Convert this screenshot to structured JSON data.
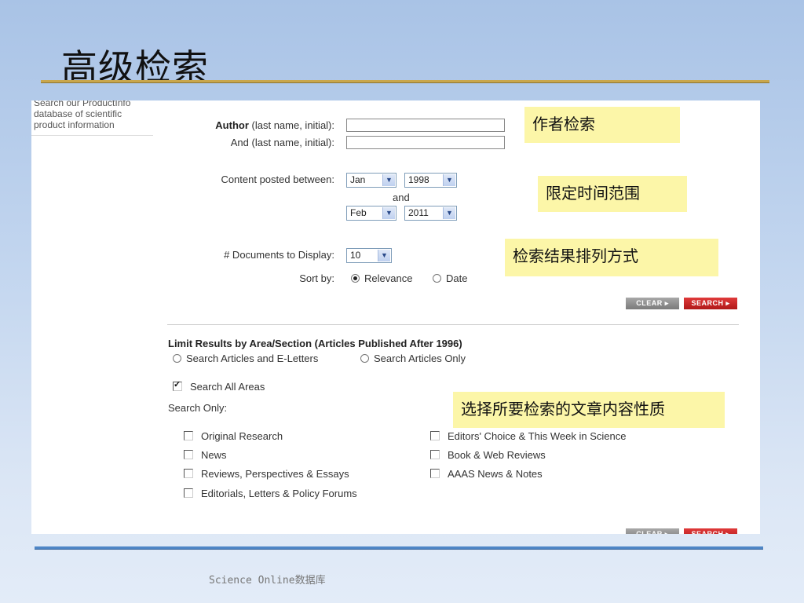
{
  "slide": {
    "title": "高级检索",
    "footer": "Science Online数据库"
  },
  "sidebar": {
    "text": "Search our ProductInfo database of scientific product information"
  },
  "form": {
    "author_label_bold": "Author",
    "author_label_rest": " (last name, initial):",
    "and_label": "And (last name, initial):",
    "content_posted_label": "Content posted between:",
    "from_month": "Jan",
    "from_year": "1998",
    "and_word": "and",
    "to_month": "Feb",
    "to_year": "2011",
    "docs_label": "# Documents to Display:",
    "docs_value": "10",
    "sort_label": "Sort by:",
    "sort_relevance": "Relevance",
    "sort_date": "Date",
    "clear_button": "CLEAR ▸",
    "search_button": "SEARCH ▸"
  },
  "limit": {
    "heading": "Limit Results by Area/Section (Articles Published After 1996)",
    "opt_articles_eletters": "Search Articles and E-Letters",
    "opt_articles_only": "Search Articles Only",
    "search_all_areas": "Search All Areas",
    "search_only": "Search Only:",
    "left_options": [
      "Original Research",
      "News",
      "Reviews, Perspectives & Essays",
      "Editorials, Letters & Policy Forums"
    ],
    "right_options": [
      "Editors' Choice & This Week in Science",
      "Book & Web Reviews",
      "AAAS News & Notes"
    ]
  },
  "callouts": {
    "author": "作者检索",
    "time": "限定时间范围",
    "sort": "检索结果排列方式",
    "type": "选择所要检索的文章内容性质"
  },
  "colors": {
    "callout_bg": "#fcf6a8",
    "search_button": "#c42020",
    "title_rule": "#c9a64c",
    "bottom_rule": "#4f86c6"
  }
}
